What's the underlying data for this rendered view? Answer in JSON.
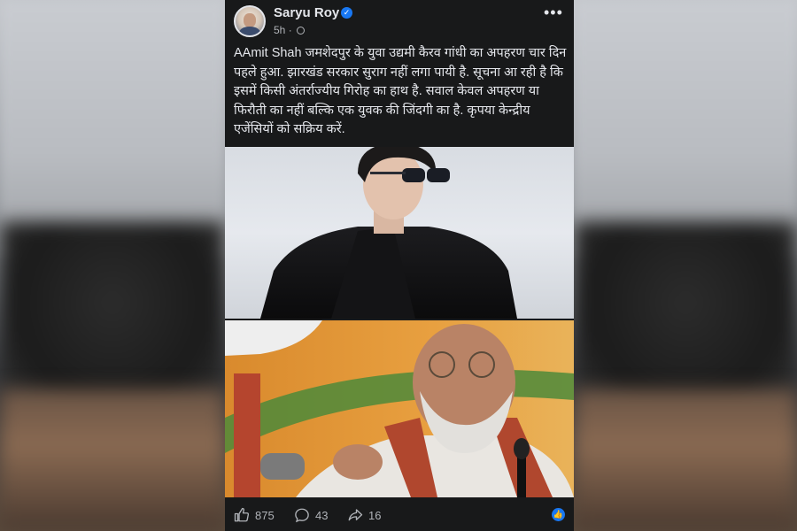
{
  "author": {
    "name": "Saryu Roy",
    "verified": true,
    "time": "5h"
  },
  "post": {
    "text": "AAmit Shah जमशेदपुर के युवा उद्यमी कैरव गांधी का अपहरण चार दिन पहले हुआ. झारखंड सरकार सुराग नहीं लगा पायी है. सूचना आ रही है कि इसमें किसी अंतर्राज्यीय गिरोह का हाथ है. सवाल केवल अपहरण या फिरौती का नहीं बल्कि एक युवक की जिंदगी का है. कृपया केन्द्रीय एजेंसियों को सक्रिय करें."
  },
  "actions": {
    "likes": "875",
    "comments": "43",
    "shares": "16"
  },
  "icons": {
    "more": "more-dots-icon",
    "privacy": "globe-icon",
    "like": "thumbs-up-icon",
    "comment": "comment-icon",
    "share": "share-icon",
    "verified": "verified-badge-icon"
  },
  "colors": {
    "background": "#18191a",
    "text": "#e4e6eb",
    "muted": "#b0b3b8",
    "accent": "#1877f2"
  }
}
